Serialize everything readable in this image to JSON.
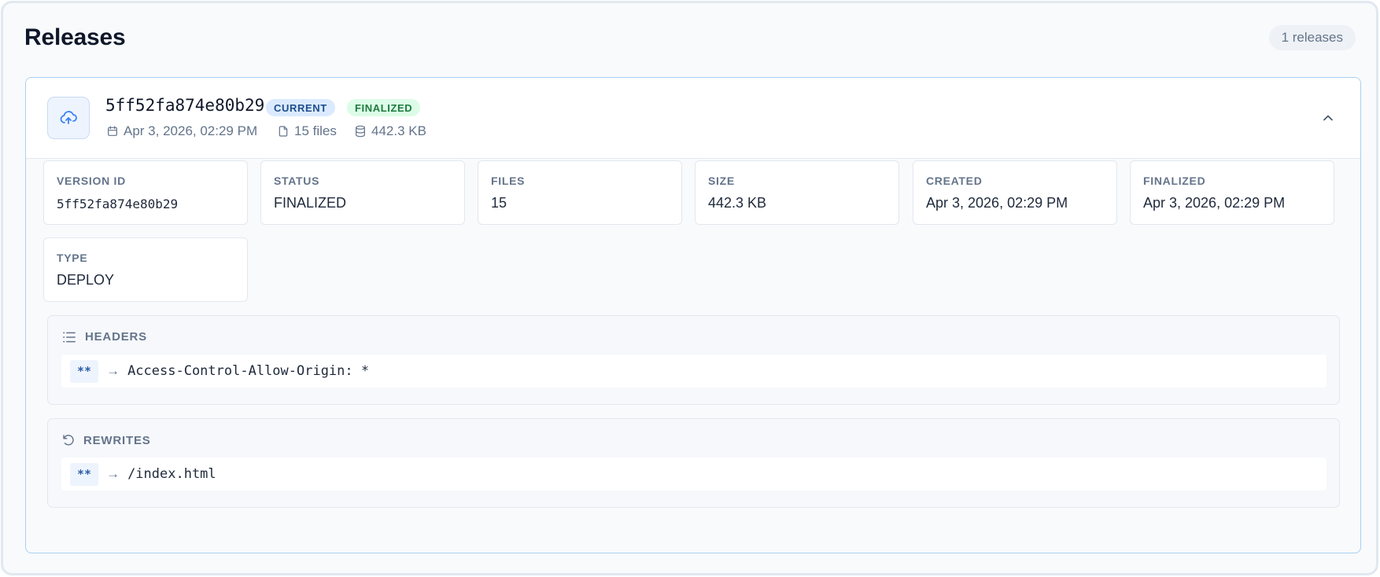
{
  "page": {
    "title": "Releases",
    "count_label": "1 releases"
  },
  "release": {
    "id": "5ff52fa874e80b29",
    "badges": {
      "current": "CURRENT",
      "finalized": "FINALIZED"
    },
    "meta": {
      "date": "Apr 3, 2026, 02:29 PM",
      "files": "15 files",
      "size": "442.3 KB"
    },
    "icons": {
      "upload": "cloud-upload-icon",
      "calendar": "calendar-icon",
      "file": "file-icon",
      "database": "database-icon",
      "collapse": "chevron-up-icon",
      "headers": "list-icon",
      "rewrites": "rotate-ccw-icon"
    },
    "fields": [
      {
        "label": "VERSION ID",
        "value": "5ff52fa874e80b29"
      },
      {
        "label": "STATUS",
        "value": "FINALIZED"
      },
      {
        "label": "FILES",
        "value": "15"
      },
      {
        "label": "SIZE",
        "value": "442.3 KB"
      },
      {
        "label": "CREATED",
        "value": "Apr 3, 2026, 02:29 PM"
      },
      {
        "label": "FINALIZED",
        "value": "Apr 3, 2026, 02:29 PM"
      },
      {
        "label": "TYPE",
        "value": "DEPLOY"
      }
    ],
    "headers": {
      "title": "HEADERS",
      "rules": [
        {
          "pattern": "**",
          "arrow": "→",
          "target": "Access-Control-Allow-Origin: *"
        }
      ]
    },
    "rewrites": {
      "title": "REWRITES",
      "rules": [
        {
          "pattern": "**",
          "arrow": "→",
          "target": "/index.html"
        }
      ]
    }
  },
  "colors": {
    "accent": "#3b82f6",
    "current_badge_bg": "#dbeafe",
    "finalized_badge_bg": "#dcfce7",
    "card_border": "#a8d0f0"
  }
}
